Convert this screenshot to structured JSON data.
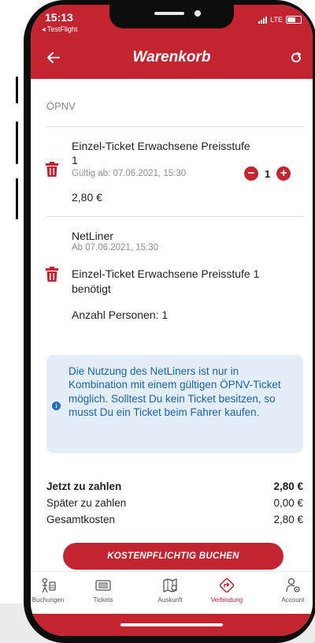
{
  "status_bar": {
    "time": "15:13",
    "back_app": "◂ TestFlight",
    "network": "LTE"
  },
  "header": {
    "title": "Warenkorb",
    "back_icon": "arrow-left-icon",
    "refresh_icon": "refresh-icon"
  },
  "section": "ÖPNV",
  "ticket": {
    "name": "Einzel-Ticket Erwachsene Preisstufe 1",
    "validity": "Gültig ab: 07.06.2021, 15:30",
    "price": "2,80 €",
    "quantity": "1"
  },
  "netliner": {
    "name": "NetLiner",
    "date": "Ab 07.06.2021, 15:30",
    "requirement": "Einzel-Ticket Erwachsene Preisstufe 1 benötigt",
    "persons": "Anzahl Personen: 1"
  },
  "info": "Die Nutzung des NetLiners ist nur in Kombination mit einem gültigen ÖPNV-Ticket möglich. Solltest Du kein Ticket besitzen, so musst Du ein Ticket beim Fahrer kaufen.",
  "totals": [
    {
      "label": "Jetzt zu zahlen",
      "value": "2,80 €"
    },
    {
      "label": "Später zu zahlen",
      "value": "0,00 €"
    },
    {
      "label": "Gesamtkosten",
      "value": "2,80 €"
    }
  ],
  "cta": "KOSTENPFLICHTIG BUCHEN",
  "tabs": [
    {
      "label": "Buchungen",
      "icon": "bookings-icon"
    },
    {
      "label": "Tickets",
      "icon": "ticket-icon"
    },
    {
      "label": "Auskunft",
      "icon": "map-icon"
    },
    {
      "label": "Verbindung",
      "icon": "route-sign-icon"
    },
    {
      "label": "Account",
      "icon": "account-icon"
    }
  ],
  "active_tab": "Verbindung",
  "colors": {
    "brand_red": "#c4242f",
    "info_blue": "#1a62b3",
    "info_bg": "#e4eef8"
  }
}
